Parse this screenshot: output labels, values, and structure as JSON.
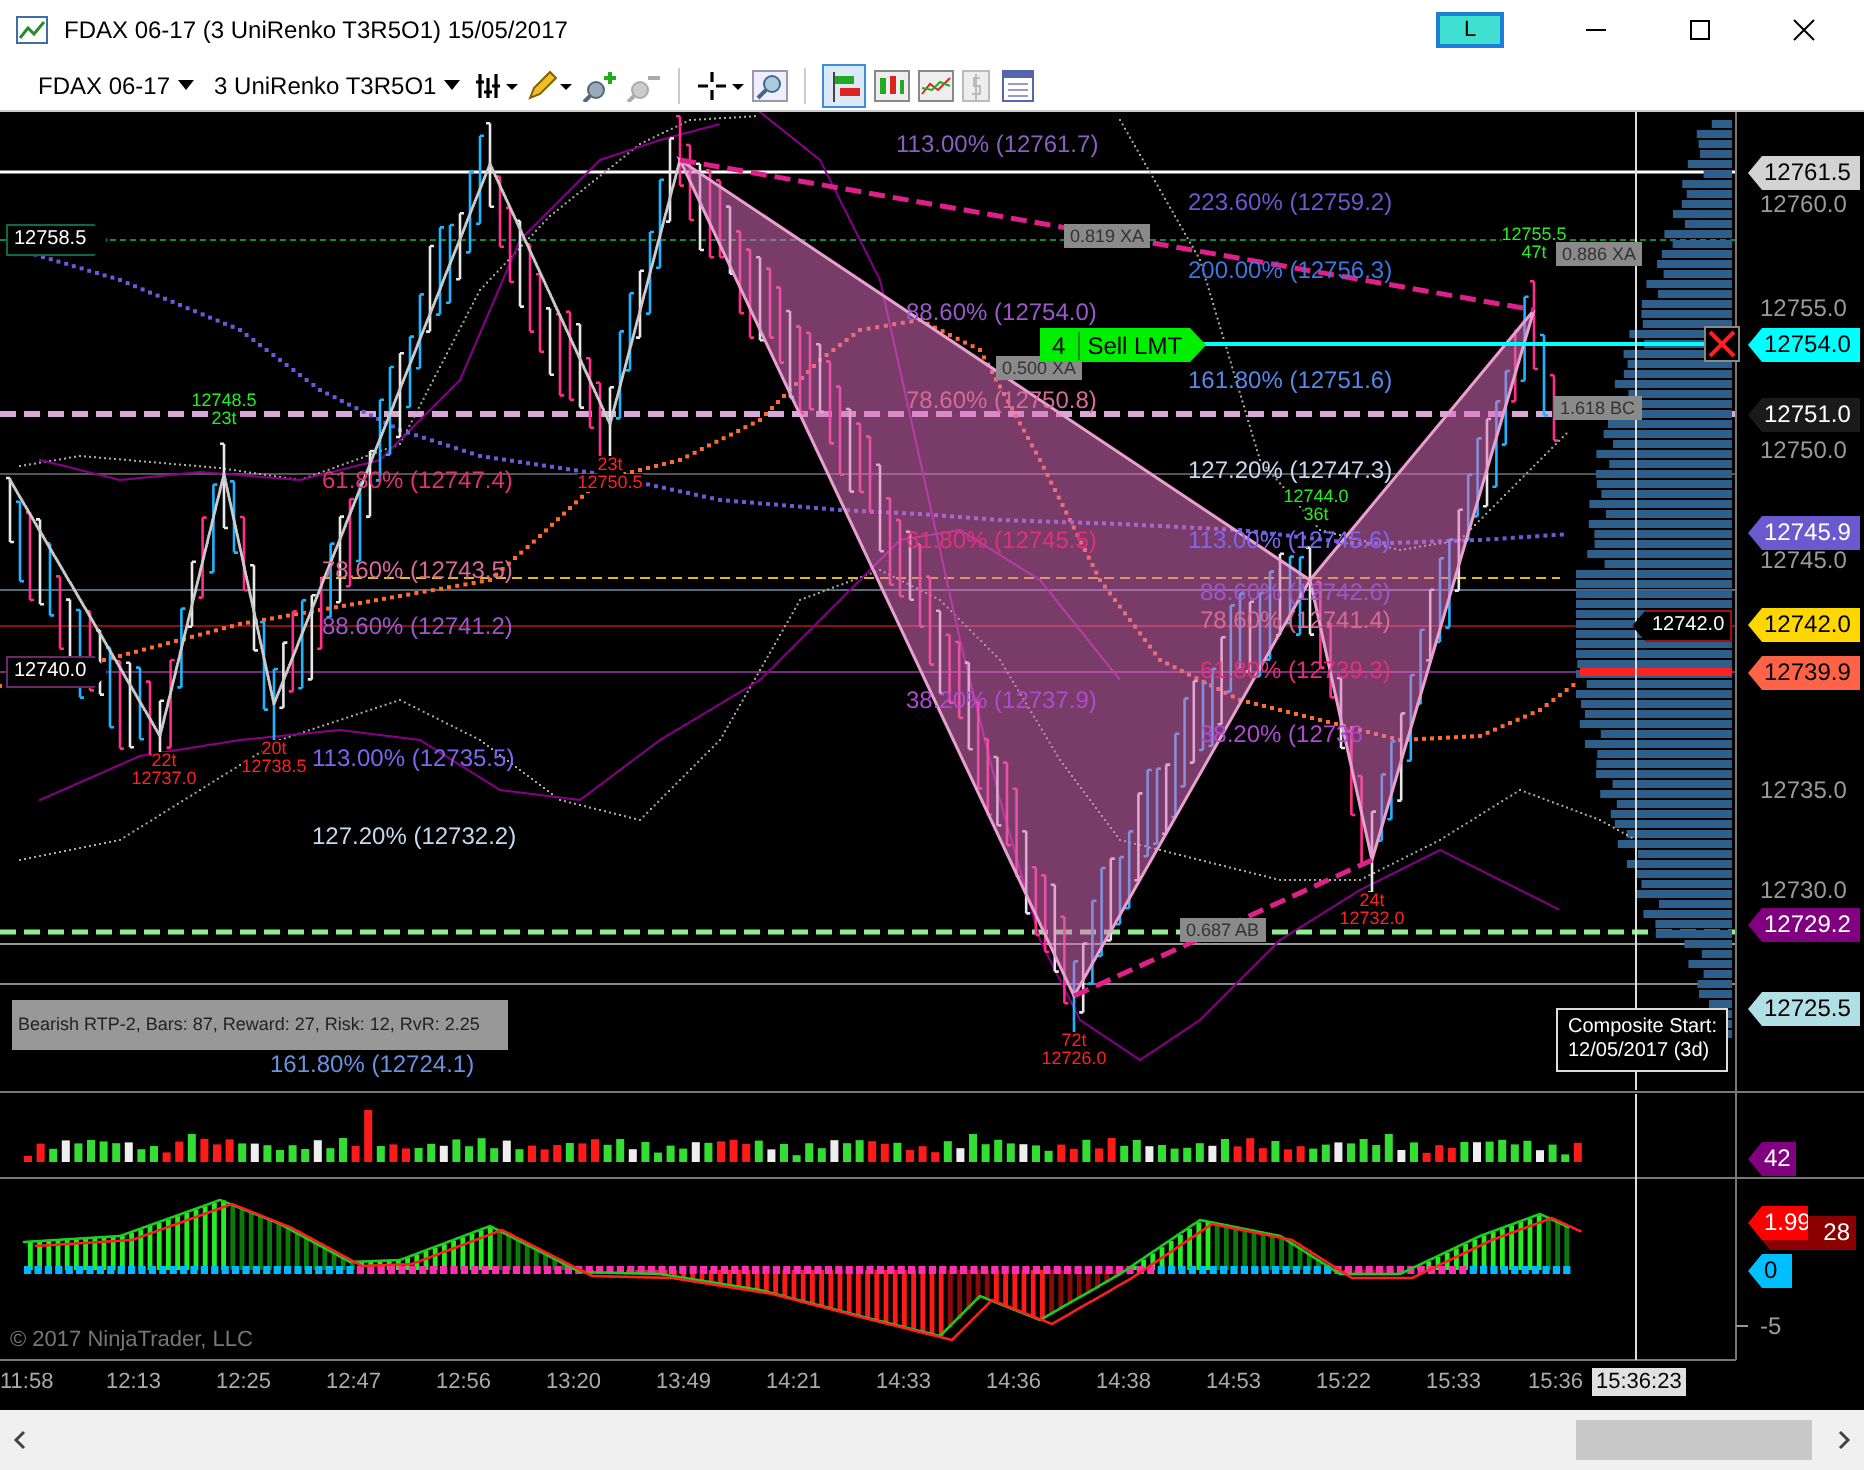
{
  "window": {
    "title": "FDAX 06-17 (3 UniRenko T3R5O1)  15/05/2017",
    "badge": "L"
  },
  "toolbar": {
    "instrument": "FDAX 06-17",
    "bar_type": "3 UniRenko T3R5O1"
  },
  "left_tags": [
    {
      "text": "12758.5",
      "color": "#0f6a44"
    },
    {
      "text": "12740.0",
      "color": "#6a2a6a"
    }
  ],
  "fib_levels": [
    {
      "text": "113.00% (12761.7)",
      "color": "#8a5fc0"
    },
    {
      "text": "223.60% (12759.2)",
      "color": "#6a5acd"
    },
    {
      "text": "200.00% (12756.3)",
      "color": "#3b78e0"
    },
    {
      "text": "88.60% (12754.0)",
      "color": "#9a58c8"
    },
    {
      "text": "161.80% (12751.6)",
      "color": "#5a88e8"
    },
    {
      "text": "78.60% (12750.8)",
      "color": "#d86a9a"
    },
    {
      "text": "61.80% (12747.4)",
      "color": "#e0307a"
    },
    {
      "text": "127.20% (12747.3)",
      "color": "#c8d8f0"
    },
    {
      "text": "61.80% (12745.5)",
      "color": "#e0307a"
    },
    {
      "text": "113.00% (12745.6)",
      "color": "#7b68ee"
    },
    {
      "text": "78.60% (12743.5)",
      "color": "#d86a9a"
    },
    {
      "text": "88.60% (12742.6)",
      "color": "#9a58c8"
    },
    {
      "text": "88.60% (12741.2)",
      "color": "#9a58c8"
    },
    {
      "text": "78.60% (12741.4)",
      "color": "#d86a9a"
    },
    {
      "text": "61.80% (12739.3)",
      "color": "#e0307a"
    },
    {
      "text": "38.20% (12737.9)",
      "color": "#b04ad0"
    },
    {
      "text": "38.20% (12736",
      "color": "#b04ad0"
    },
    {
      "text": "113.00% (12735.5)",
      "color": "#7b68ee"
    },
    {
      "text": "127.20% (12732.2)",
      "color": "#c8d8f0"
    },
    {
      "text": "161.80% (12724.1)",
      "color": "#6a90e0"
    }
  ],
  "pivots": [
    {
      "kind": "high",
      "price": "12755.5",
      "ticks": "47t"
    },
    {
      "kind": "high",
      "price": "12748.5",
      "ticks": "23t"
    },
    {
      "kind": "low",
      "price": "12750.5",
      "ticks": "23t"
    },
    {
      "kind": "high",
      "price": "12744.0",
      "ticks": "36t"
    },
    {
      "kind": "low",
      "price": "12738.5",
      "ticks": "20t"
    },
    {
      "kind": "low",
      "price": "12737.0",
      "ticks": "22t"
    },
    {
      "kind": "low",
      "price": "12732.0",
      "ticks": "24t"
    },
    {
      "kind": "low",
      "price": "12726.0",
      "ticks": "72t"
    }
  ],
  "ratio_tags": [
    "0.819 XA",
    "0.886 XA",
    "0.500 XA",
    "1.618 BC",
    "0.687 AB"
  ],
  "order": {
    "quantity": "4",
    "type": "Sell LMT"
  },
  "inner_tag": "12742.0",
  "pattern_info": "Bearish RTP-2, Bars: 87, Reward: 27, Risk: 12, RvR: 2.25",
  "composite": {
    "title": "Composite Start:",
    "date": "12/05/2017 (3d)"
  },
  "price_axis": [
    "12760.0",
    "12755.0",
    "12750.0",
    "12745.0",
    "12735.0",
    "12730.0"
  ],
  "price_markers": [
    {
      "text": "12761.5",
      "color": "#d3d3d3"
    },
    {
      "text": "12754.0",
      "color": "#00ffff"
    },
    {
      "text": "12751.0",
      "color": "#1a1a1a"
    },
    {
      "text": "12745.9",
      "color": "#6a5acd"
    },
    {
      "text": "12742.0",
      "color": "#ffd700"
    },
    {
      "text": "12739.9",
      "color": "#ff6347"
    },
    {
      "text": "12729.2",
      "color": "#800080"
    },
    {
      "text": "12725.5",
      "color": "#b0e0e6"
    }
  ],
  "volume_marker": {
    "text": "42",
    "color": "#800080"
  },
  "osc_markers": [
    {
      "text": "28",
      "color": "#8b0000"
    },
    {
      "text": "1.99",
      "color": "#ff0000"
    },
    {
      "text": "0",
      "color": "#00bfff"
    }
  ],
  "osc_axis": [
    "-5"
  ],
  "copyright": "© 2017 NinjaTrader, LLC",
  "time_axis": [
    "11:58",
    "12:13",
    "12:25",
    "12:47",
    "12:56",
    "13:20",
    "13:49",
    "14:21",
    "14:33",
    "14:36",
    "14:38",
    "14:53",
    "15:22",
    "15:33",
    "15:36"
  ],
  "crosshair_time": "15:36:23"
}
